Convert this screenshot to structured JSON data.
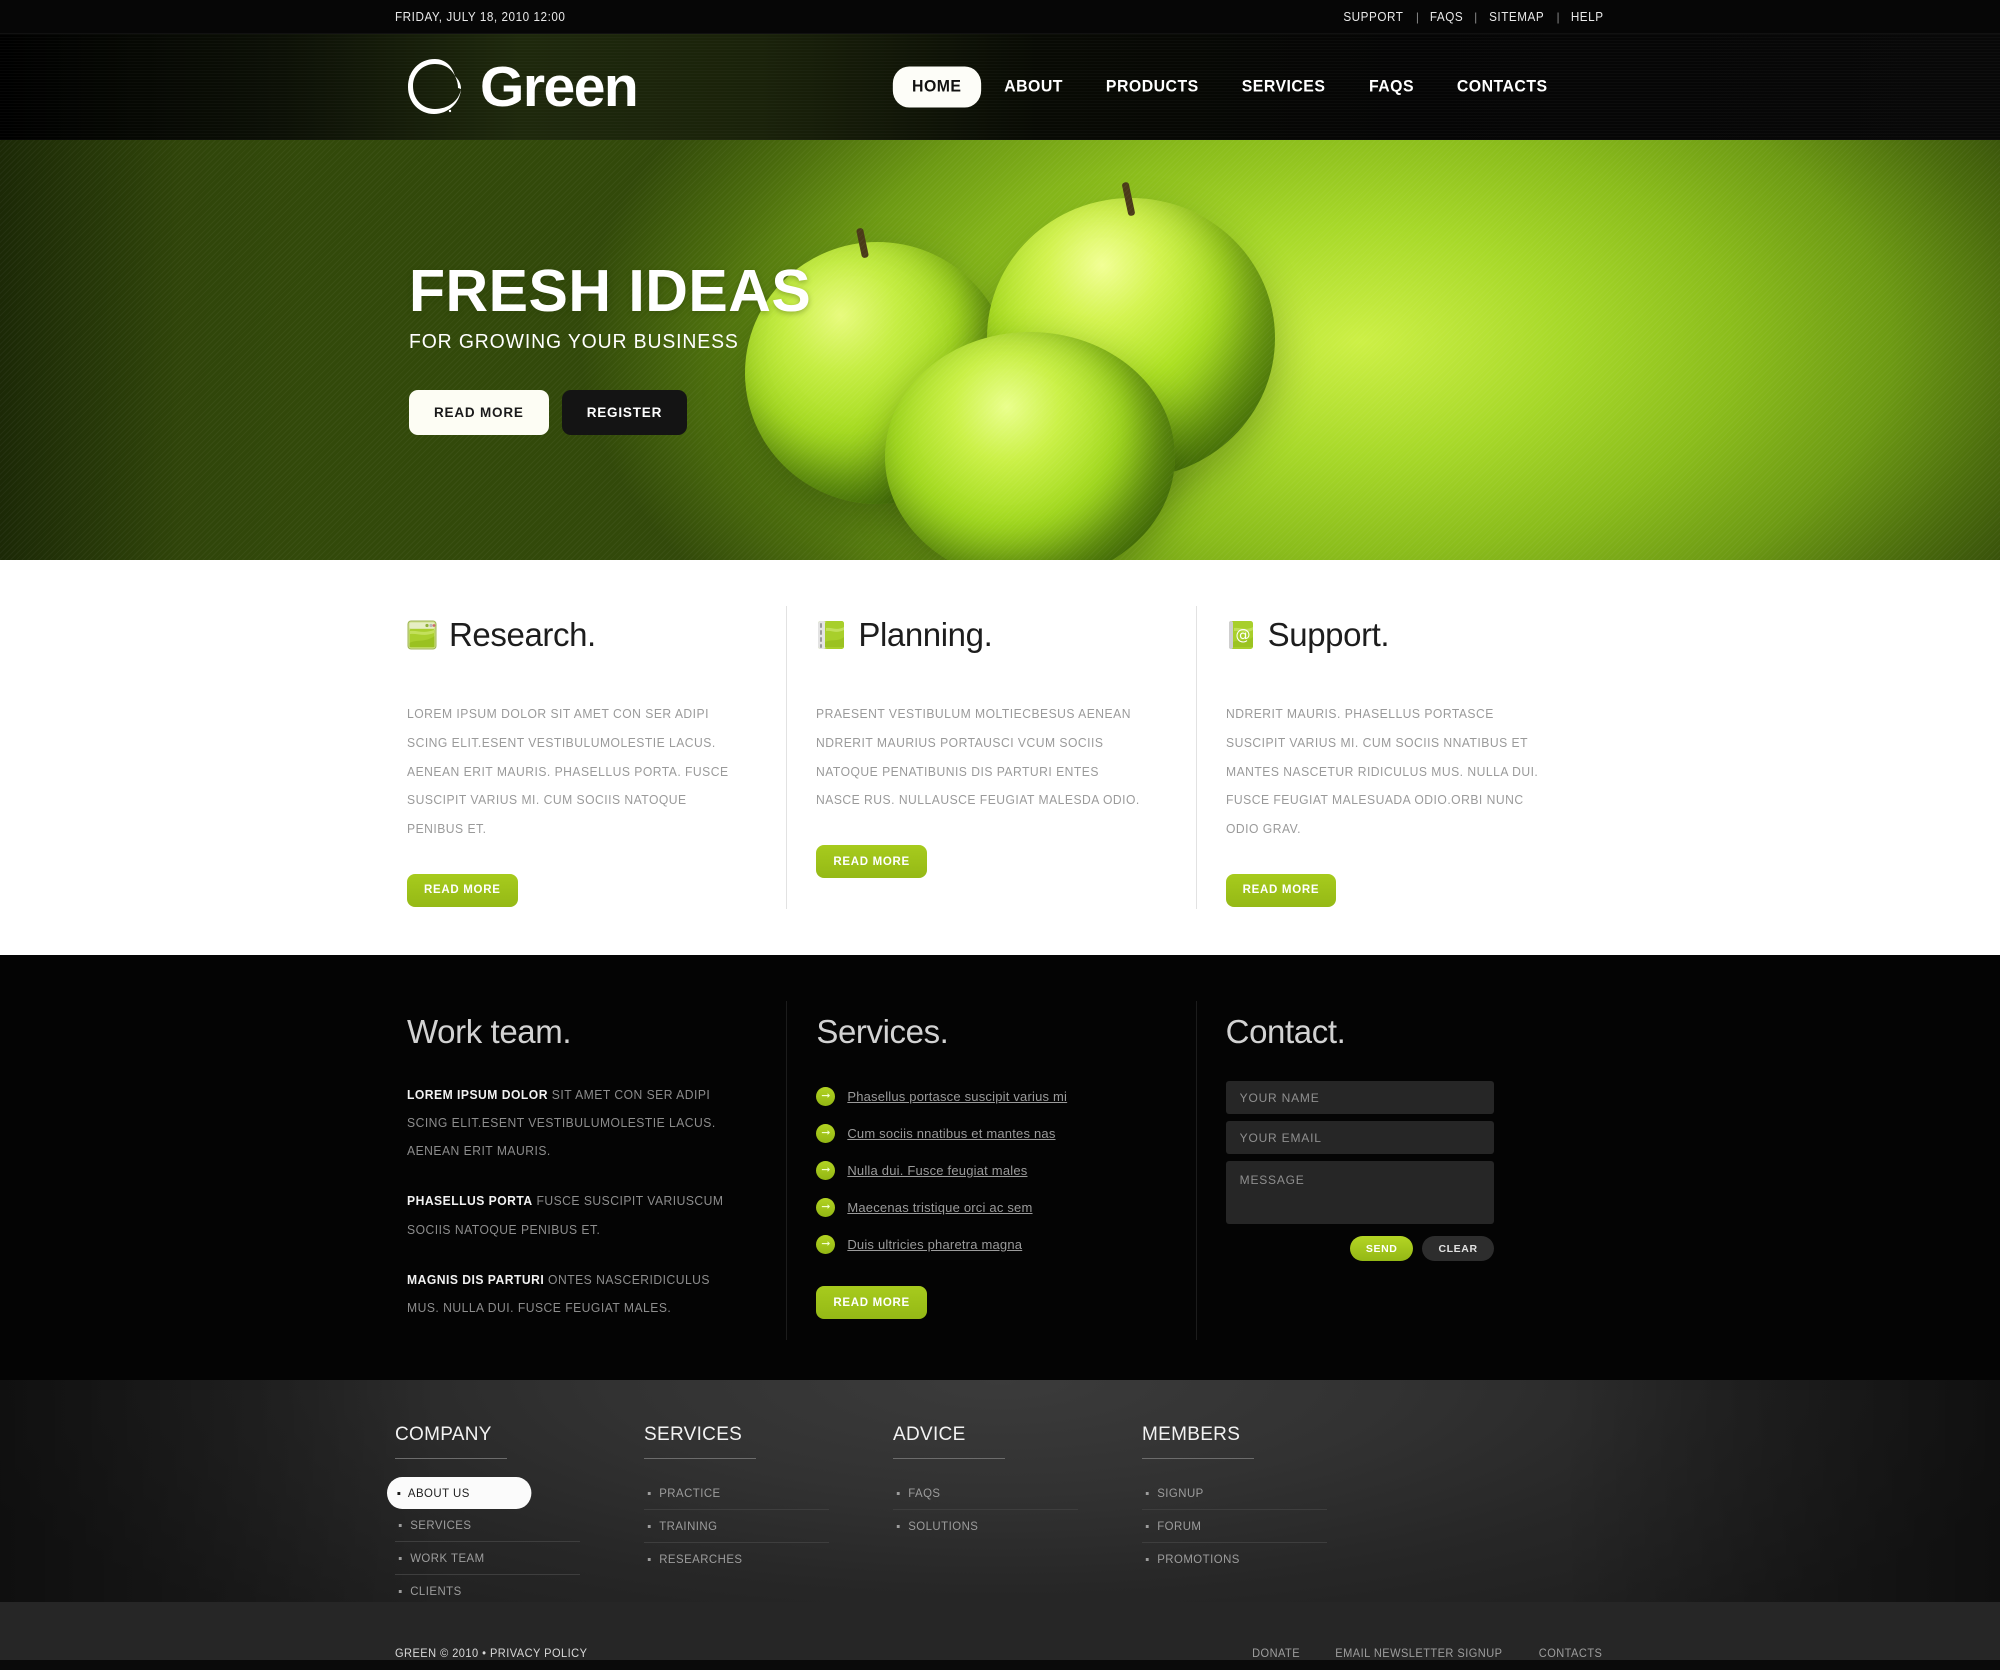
{
  "topbar": {
    "date": "FRIDAY, JULY 18, 2010 12:00",
    "links": [
      {
        "label": "SUPPORT"
      },
      {
        "label": "FAQS"
      },
      {
        "label": "SITEMAP"
      },
      {
        "label": "HELP"
      }
    ],
    "separator": "|"
  },
  "header": {
    "logo_text": "Green",
    "logo_icon": "brush-circle-icon",
    "nav": [
      {
        "label": "HOME",
        "active": true
      },
      {
        "label": "ABOUT",
        "active": false
      },
      {
        "label": "PRODUCTS",
        "active": false
      },
      {
        "label": "SERVICES",
        "active": false
      },
      {
        "label": "FAQS",
        "active": false
      },
      {
        "label": "CONTACTS",
        "active": false
      }
    ]
  },
  "hero": {
    "title": "FRESH IDEAS",
    "subtitle": "FOR GROWING YOUR BUSINESS",
    "primary_button": "READ MORE",
    "secondary_button": "REGISTER",
    "image_subject": "three green apples"
  },
  "features": [
    {
      "icon": "browser-window-icon",
      "title": "Research.",
      "body": "LOREM IPSUM DOLOR SIT AMET CON SER ADIPI SCING ELIT.ESENT VESTIBULUMOLESTIE LACUS. AENEAN ERIT MAURIS. PHASELLUS PORTA. FUSCE SUSCIPIT VARIUS MI. CUM SOCIIS NATOQUE PENIBUS ET.",
      "button": "READ MORE"
    },
    {
      "icon": "notebook-icon",
      "title": "Planning.",
      "body": "PRAESENT VESTIBULUM MOLTIECBESUS AENEAN NDRERIT MAURIUS PORTAUSCI VCUM SOCIIS NATOQUE PENATIBUNIS DIS PARTURI ENTES NASCE RUS. NULLAUSCE FEUGIAT MALESDA ODIO.",
      "button": "READ MORE"
    },
    {
      "icon": "at-sign-book-icon",
      "title": "Support.",
      "body": "NDRERIT MAURIS. PHASELLUS PORTASCE SUSCIPIT VARIUS MI. CUM SOCIIS NNATIBUS ET MANTES NASCETUR RIDICULUS MUS. NULLA DUI. FUSCE FEUGIAT MALESUADA ODIO.ORBI NUNC ODIO GRAV.",
      "button": "READ MORE"
    }
  ],
  "work_team": {
    "title": "Work team.",
    "paragraphs": [
      {
        "lead": "LOREM IPSUM DOLOR",
        "rest": " SIT AMET CON SER ADIPI SCING ELIT.ESENT VESTIBULUMOLESTIE LACUS. AENEAN ERIT MAURIS."
      },
      {
        "lead": "PHASELLUS PORTA",
        "rest": " FUSCE SUSCIPIT VARIUSCUM SOCIIS NATOQUE PENIBUS ET."
      },
      {
        "lead": "MAGNIS DIS PARTURI",
        "rest": " ONTES NASCERIDICULUS MUS. NULLA DUI. FUSCE FEUGIAT MALES."
      }
    ]
  },
  "services": {
    "title": "Services.",
    "bullet_icon": "arrow-right-circle-icon",
    "items": [
      {
        "label": "Phasellus portasce suscipit varius mi"
      },
      {
        "label": "Cum sociis nnatibus et mantes nas"
      },
      {
        "label": "Nulla dui. Fusce feugiat males"
      },
      {
        "label": "Maecenas tristique orci ac sem"
      },
      {
        "label": "Duis ultricies pharetra magna"
      }
    ],
    "button": "READ MORE"
  },
  "contact": {
    "title": "Contact.",
    "name_placeholder": "YOUR NAME",
    "name_value": "",
    "email_placeholder": "YOUR EMAIL",
    "email_value": "",
    "message_placeholder": "MESSAGE",
    "message_value": "",
    "send_label": "SEND",
    "clear_label": "CLEAR"
  },
  "footer": {
    "columns": [
      {
        "title": "COMPANY",
        "items": [
          {
            "label": "ABOUT US",
            "selected": true
          },
          {
            "label": "SERVICES",
            "selected": false
          },
          {
            "label": "WORK  TEAM",
            "selected": false
          },
          {
            "label": "CLIENTS",
            "selected": false
          }
        ]
      },
      {
        "title": "SERVICES",
        "items": [
          {
            "label": "PRACTICE",
            "selected": false
          },
          {
            "label": "TRAINING",
            "selected": false
          },
          {
            "label": "RESEARCHES",
            "selected": false
          }
        ]
      },
      {
        "title": "ADVICE",
        "items": [
          {
            "label": "FAQS",
            "selected": false
          },
          {
            "label": "SOLUTIONS",
            "selected": false
          }
        ]
      },
      {
        "title": "MEMBERS",
        "items": [
          {
            "label": "SIGNUP",
            "selected": false
          },
          {
            "label": "FORUM",
            "selected": false
          },
          {
            "label": "PROMOTIONS",
            "selected": false
          }
        ]
      }
    ],
    "copyright": "GREEN © 2010 • PRIVACY POLICY",
    "bottom_links": [
      {
        "label": "DONATE"
      },
      {
        "label": "EMAIL NEWSLETTER SIGNUP"
      },
      {
        "label": "CONTACTS"
      }
    ]
  },
  "colors": {
    "accent_green": "#9ec11a",
    "hero_green": "#a8d92a",
    "dark_bg": "#040404",
    "footer_bg": "#323232"
  }
}
